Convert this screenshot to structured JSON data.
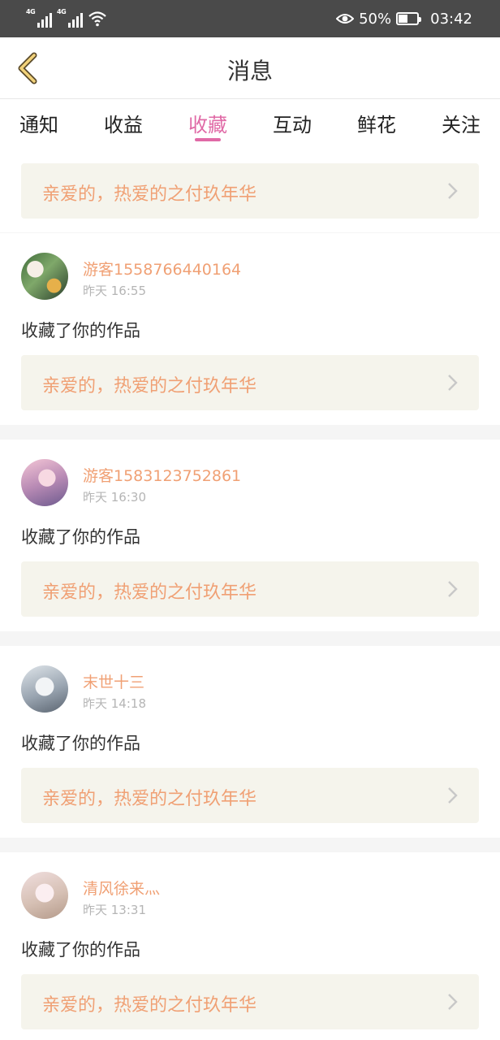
{
  "status_bar": {
    "network_1": "4G",
    "network_2": "4G",
    "battery": "50%",
    "battery_level": 0.5,
    "time": "03:42"
  },
  "header": {
    "title": "消息"
  },
  "tabs": [
    {
      "label": "通知"
    },
    {
      "label": "收益"
    },
    {
      "label": "收藏",
      "active": true
    },
    {
      "label": "互动"
    },
    {
      "label": "鲜花"
    },
    {
      "label": "关注"
    }
  ],
  "first_work": "亲爱的，热爱的之付玖年华",
  "items": [
    {
      "user": "游客1558766440164",
      "time": "昨天 16:55",
      "action": "收藏了你的作品",
      "work": "亲爱的，热爱的之付玖年华"
    },
    {
      "user": "游客1583123752861",
      "time": "昨天 16:30",
      "action": "收藏了你的作品",
      "work": "亲爱的，热爱的之付玖年华"
    },
    {
      "user": "末世十三",
      "time": "昨天 14:18",
      "action": "收藏了你的作品",
      "work": "亲爱的，热爱的之付玖年华"
    },
    {
      "user": "清风徐来灬",
      "time": "昨天 13:31",
      "action": "收藏了你的作品",
      "work": "亲爱的，热爱的之付玖年华"
    }
  ],
  "colors": {
    "accent_pink": "#e06aa6",
    "accent_orange": "#f0a074",
    "back_icon": "#f2d27a",
    "card_bg": "#f5f4ec"
  },
  "icons": {
    "back": "chevron-left-icon",
    "card_arrow": "chevron-right-icon",
    "eye": "eye-icon",
    "wifi": "wifi-icon",
    "battery": "battery-icon"
  }
}
